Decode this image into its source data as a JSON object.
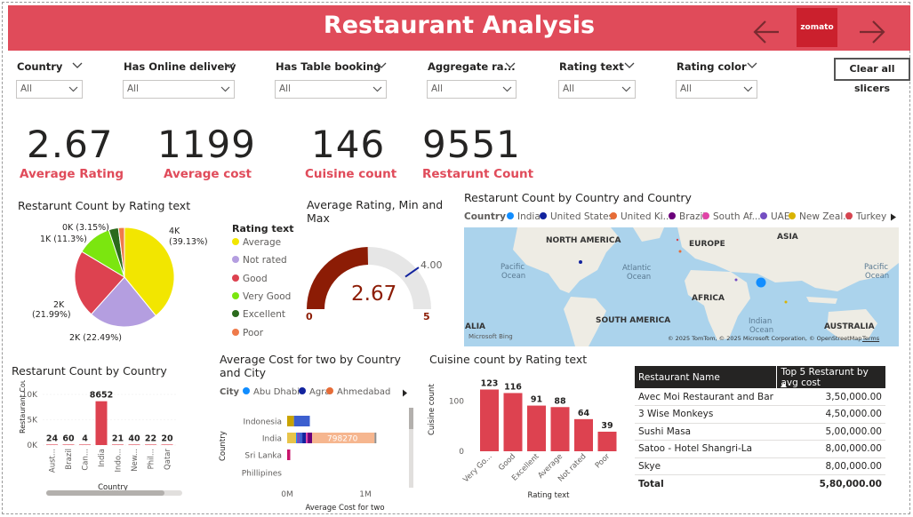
{
  "header": {
    "title": "Restaurant Analysis",
    "logo_text": "zomato"
  },
  "slicers": [
    {
      "label": "Country",
      "value": "All"
    },
    {
      "label": "Has Online delivery",
      "value": "All"
    },
    {
      "label": "Has Table booking",
      "value": "All"
    },
    {
      "label": "Aggregate ra...",
      "value": "All"
    },
    {
      "label": "Rating text",
      "value": "All"
    },
    {
      "label": "Rating color",
      "value": "All"
    }
  ],
  "clear_button": "Clear all slicers",
  "kpis": [
    {
      "value": "2.67",
      "label": "Average Rating"
    },
    {
      "value": "1199",
      "label": "Average cost"
    },
    {
      "value": "146",
      "label": "Cuisine count"
    },
    {
      "value": "9551",
      "label": "Restarunt Count"
    }
  ],
  "colors": {
    "accent": "#e04b5a",
    "bar": "#dd4250",
    "gauge": "#8c1c05"
  },
  "pie": {
    "title": "Restarunt Count by Rating text",
    "legend_title": "Rating text",
    "labels": {
      "average": "4K",
      "average_pct": "(39.13%)",
      "notrated": "2K (22.49%)",
      "good": "2K",
      "good_pct": "(21.99%)",
      "verygood": "1K (11.3%)",
      "excellent": "0K (3.15%)"
    }
  },
  "gauge": {
    "title": "Average Rating, Min and Max",
    "value_label": "2.67",
    "min_label": "0",
    "max_label": "5",
    "target_label": "4.00"
  },
  "map": {
    "title": "Restarunt Count by Country and Country",
    "legend_title": "Country",
    "labels": {
      "na": "NORTH AMERICA",
      "eu": "EUROPE",
      "as": "ASIA",
      "pac1": "Pacific",
      "pac1b": "Ocean",
      "atl": "Atlantic",
      "atlb": "Ocean",
      "af": "AFRICA",
      "pac2": "Pacific",
      "pac2b": "Ocean",
      "sa": "SOUTH AMERICA",
      "ind": "Indian",
      "indb": "Ocean",
      "aus": "AUSTRALIA",
      "alia": "ALIA",
      "bing": "Microsoft Bing",
      "copyright": "© 2025 TomTom, © 2025 Microsoft Corporation, © OpenStreetMap",
      "terms": "Terms"
    }
  },
  "chart_data": [
    {
      "type": "pie",
      "title": "Restarunt Count by Rating text",
      "legend_title": "Rating text",
      "categories": [
        "Average",
        "Not rated",
        "Good",
        "Very Good",
        "Excellent",
        "Poor"
      ],
      "values": [
        3737,
        2148,
        2100,
        1079,
        301,
        186
      ],
      "colors": [
        "#f2e600",
        "#b49ee0",
        "#dd4250",
        "#7be60f",
        "#2b6a1c",
        "#ef7a4a"
      ]
    },
    {
      "type": "bar",
      "title": "Restarunt Count by Country",
      "xlabel": "Country",
      "ylabel": "Restaurant Count",
      "categories": [
        "Aust...",
        "Brazil",
        "Can...",
        "India",
        "Indo...",
        "New...",
        "Phil...",
        "Qatar"
      ],
      "values": [
        24,
        60,
        4,
        8652,
        21,
        40,
        22,
        20
      ],
      "yticks": [
        "0K",
        "5K",
        "10K"
      ],
      "ylim": [
        0,
        10000
      ]
    },
    {
      "type": "bar",
      "title": "Average Cost for two by Country and City",
      "orientation": "horizontal",
      "stacked": true,
      "legend_title": "City",
      "legend": [
        "Abu Dhabi",
        "Agra",
        "Ahmedabad"
      ],
      "xlabel": "Average Cost for two",
      "ylabel": "Country",
      "categories": [
        "Indonesia",
        "India",
        "Sri Lanka",
        "Phillipines"
      ],
      "data_labels": {
        "India": "798270"
      },
      "xticks": [
        "0M",
        "1M"
      ],
      "series": [
        {
          "name": "Indonesia",
          "values": [
            290000,
            0,
            0,
            0
          ]
        },
        {
          "name": "India",
          "values": [
            0,
            1140000,
            0,
            0
          ]
        },
        {
          "name": "Sri Lanka",
          "values": [
            0,
            0,
            20000,
            0
          ]
        },
        {
          "name": "Phillipines",
          "values": [
            0,
            0,
            0,
            0
          ]
        }
      ]
    },
    {
      "type": "bar",
      "title": "Cuisine count by Rating text",
      "xlabel": "Rating text",
      "ylabel": "Cuisine count",
      "categories": [
        "Very Go...",
        "Good",
        "Excellent",
        "Average",
        "Not rated",
        "Poor"
      ],
      "values": [
        123,
        116,
        91,
        88,
        64,
        39
      ],
      "yticks": [
        "0",
        "100"
      ]
    },
    {
      "type": "table",
      "columns": [
        "Restaurant Name",
        "Top 5 Restarunt by avg cost"
      ],
      "rows": [
        [
          "Avec Moi Restaurant and Bar",
          "3,50,000.00"
        ],
        [
          "3 Wise Monkeys",
          "4,50,000.00"
        ],
        [
          "Sushi Masa",
          "5,00,000.00"
        ],
        [
          "Satoo - Hotel Shangri-La",
          "8,00,000.00"
        ],
        [
          "Skye",
          "8,00,000.00"
        ]
      ],
      "total_label": "Total",
      "total": "5,80,000.00"
    },
    {
      "type": "scatter",
      "title": "Restarunt Count by Country and Country",
      "legend_title": "Country",
      "legend": [
        "India",
        "United States",
        "United Ki...",
        "Brazil",
        "South Af...",
        "UAE",
        "New Zeal...",
        "Turkey"
      ],
      "legend_colors": [
        "#118dff",
        "#12239e",
        "#e66c37",
        "#6b007b",
        "#e044a7",
        "#744ec2",
        "#d9b300",
        "#d64550"
      ]
    }
  ]
}
